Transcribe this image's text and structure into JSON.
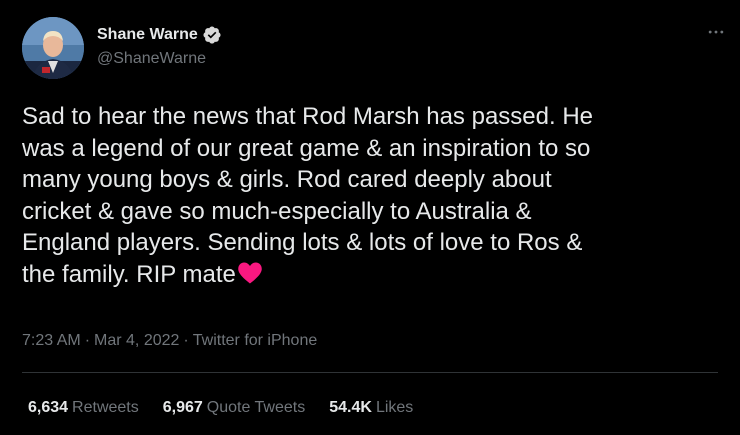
{
  "author": {
    "display_name": "Shane Warne",
    "handle": "@ShaneWarne",
    "verified_icon": "verified-badge-icon",
    "verified_color": "#d9d9d9"
  },
  "more_icon": "more-horizontal-icon",
  "tweet": {
    "text": "Sad to hear the news that Rod Marsh has passed. He\nwas a legend of our great game & an inspiration to so\nmany young boys &  girls. Rod cared deeply about\ncricket & gave so much-especially to Australia &\nEngland players. Sending lots & lots of love to Ros &\nthe family. RIP mate",
    "emoji": "red-heart-icon",
    "emoji_color": "#f91880"
  },
  "meta": {
    "time": "7:23 AM",
    "separator1": "·",
    "date": "Mar 4, 2022",
    "separator2": "·",
    "source": "Twitter for iPhone"
  },
  "stats": [
    {
      "count": "6,634",
      "label": "Retweets"
    },
    {
      "count": "6,967",
      "label": "Quote Tweets"
    },
    {
      "count": "54.4K",
      "label": "Likes"
    }
  ],
  "colors": {
    "background": "#000000",
    "primary_text": "#e7e9ea",
    "secondary_text": "#71767b",
    "divider": "#2f3336"
  }
}
